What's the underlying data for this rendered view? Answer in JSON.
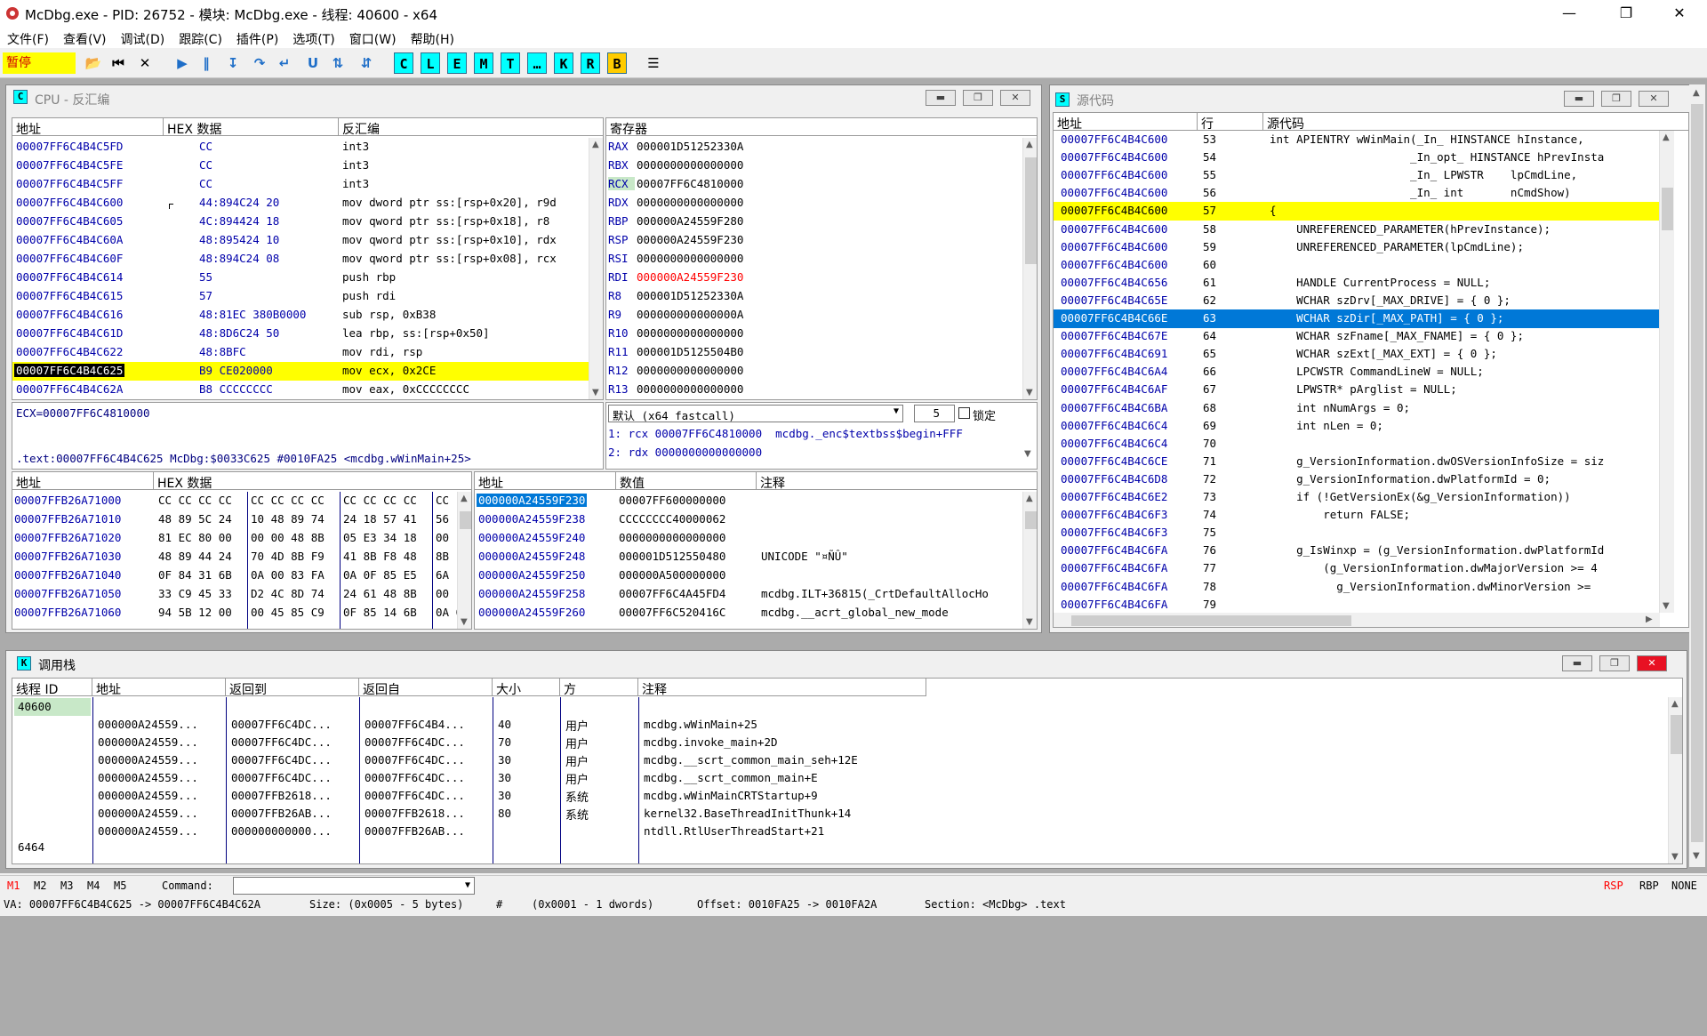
{
  "window": {
    "title": "McDbg.exe - PID: 26752 - 模块: McDbg.exe - 线程: 40600 - x64"
  },
  "menu": [
    "文件(F)",
    "查看(V)",
    "调试(D)",
    "跟踪(C)",
    "插件(P)",
    "选项(T)",
    "窗口(W)",
    "帮助(H)"
  ],
  "toolbar": {
    "state_label": "暂停",
    "letters": [
      "C",
      "L",
      "E",
      "M",
      "T",
      "…",
      "K",
      "R",
      "B"
    ]
  },
  "cpu": {
    "title": "CPU - 反汇编",
    "icon_letter": "C",
    "disasm_headers": [
      "地址",
      "HEX 数据",
      "反汇编"
    ],
    "disasm_rows": [
      {
        "addr": "00007FF6C4B4C5FD",
        "hex": "CC",
        "asm": "int3"
      },
      {
        "addr": "00007FF6C4B4C5FE",
        "hex": "CC",
        "asm": "int3"
      },
      {
        "addr": "00007FF6C4B4C5FF",
        "hex": "CC",
        "asm": "int3"
      },
      {
        "addr": "00007FF6C4B4C600",
        "hex": "44:894C24 20",
        "asm": "mov dword ptr ss:[rsp+0x20], r9d"
      },
      {
        "addr": "00007FF6C4B4C605",
        "hex": "4C:894424 18",
        "asm": "mov qword ptr ss:[rsp+0x18], r8"
      },
      {
        "addr": "00007FF6C4B4C60A",
        "hex": "48:895424 10",
        "asm": "mov qword ptr ss:[rsp+0x10], rdx"
      },
      {
        "addr": "00007FF6C4B4C60F",
        "hex": "48:894C24 08",
        "asm": "mov qword ptr ss:[rsp+0x08], rcx"
      },
      {
        "addr": "00007FF6C4B4C614",
        "hex": "55",
        "asm": "push rbp"
      },
      {
        "addr": "00007FF6C4B4C615",
        "hex": "57",
        "asm": "push rdi"
      },
      {
        "addr": "00007FF6C4B4C616",
        "hex": "48:81EC 380B0000",
        "asm": "sub rsp, 0xB38"
      },
      {
        "addr": "00007FF6C4B4C61D",
        "hex": "48:8D6C24 50",
        "asm": "lea rbp, ss:[rsp+0x50]"
      },
      {
        "addr": "00007FF6C4B4C622",
        "hex": "48:8BFC",
        "asm": "mov rdi, rsp"
      },
      {
        "addr": "00007FF6C4B4C625",
        "hex": "B9 CE020000",
        "asm": "mov ecx, 0x2CE"
      },
      {
        "addr": "00007FF6C4B4C62A",
        "hex": "B8 CCCCCCCC",
        "asm": "mov eax, 0xCCCCCCCC"
      }
    ],
    "registers_header": "寄存器",
    "registers": [
      {
        "name": "RAX",
        "value": "000001D51252330A"
      },
      {
        "name": "RBX",
        "value": "0000000000000000"
      },
      {
        "name": "RCX",
        "value": "00007FF6C4810000"
      },
      {
        "name": "RDX",
        "value": "0000000000000000"
      },
      {
        "name": "RBP",
        "value": "000000A24559F280"
      },
      {
        "name": "RSP",
        "value": "000000A24559F230"
      },
      {
        "name": "RSI",
        "value": "0000000000000000"
      },
      {
        "name": "RDI",
        "value": "000000A24559F230"
      },
      {
        "name": "R8",
        "value": "000001D51252330A"
      },
      {
        "name": "R9",
        "value": "000000000000000A"
      },
      {
        "name": "R10",
        "value": "0000000000000000"
      },
      {
        "name": "R11",
        "value": "000001D5125504B0"
      },
      {
        "name": "R12",
        "value": "0000000000000000"
      },
      {
        "name": "R13",
        "value": "0000000000000000"
      }
    ],
    "info_line1": "ECX=00007FF6C4810000",
    "info_line2": ".text:00007FF6C4B4C625 McDbg:$0033C625 #0010FA25 <mcdbg.wWinMain+25>",
    "callconv": "默认 (x64 fastcall)",
    "argcount": "5",
    "lock_label": "锁定",
    "args": [
      "1: rcx 00007FF6C4810000  mcdbg._enc$textbss$begin+FFF",
      "2: rdx 0000000000000000"
    ],
    "dump_headers": [
      "地址",
      "HEX 数据"
    ],
    "dump_rows": [
      {
        "addr": "00007FFB26A71000",
        "g1": "CC CC CC CC",
        "g2": "CC CC CC CC",
        "g3": "CC CC CC CC",
        "g4": "CC"
      },
      {
        "addr": "00007FFB26A71010",
        "g1": "48 89 5C 24",
        "g2": "10 48 89 74",
        "g3": "24 18 57 41",
        "g4": "56"
      },
      {
        "addr": "00007FFB26A71020",
        "g1": "81 EC 80 00",
        "g2": "00 00 48 8B",
        "g3": "05 E3 34 18",
        "g4": "00"
      },
      {
        "addr": "00007FFB26A71030",
        "g1": "48 89 44 24",
        "g2": "70 4D 8B F9",
        "g3": "41 8B F8 48",
        "g4": "8B"
      },
      {
        "addr": "00007FFB26A71040",
        "g1": "0F 84 31 6B",
        "g2": "0A 00 83 FA",
        "g3": "0A 0F 85 E5",
        "g4": "6A"
      },
      {
        "addr": "00007FFB26A71050",
        "g1": "33 C9 45 33",
        "g2": "D2 4C 8D 74",
        "g3": "24 61 48 8B",
        "g4": "00"
      },
      {
        "addr": "00007FFB26A71060",
        "g1": "94 5B 12 00",
        "g2": "00 45 85 C9",
        "g3": "0F 85 14 6B",
        "g4": "0A 00"
      }
    ],
    "stack_headers": [
      "地址",
      "数值",
      "注释"
    ],
    "stack_rows": [
      {
        "addr": "000000A24559F230",
        "val": "00007FF600000000",
        "note": ""
      },
      {
        "addr": "000000A24559F238",
        "val": "CCCCCCCC40000062",
        "note": ""
      },
      {
        "addr": "000000A24559F240",
        "val": "0000000000000000",
        "note": ""
      },
      {
        "addr": "000000A24559F248",
        "val": "000001D512550480",
        "note": "UNICODE \"¤ÑÛ\""
      },
      {
        "addr": "000000A24559F250",
        "val": "000000A500000000",
        "note": ""
      },
      {
        "addr": "000000A24559F258",
        "val": "00007FF6C4A45FD4",
        "note": "mcdbg.ILT+36815(_CrtDefaultAllocHo"
      },
      {
        "addr": "000000A24559F260",
        "val": "00007FF6C520416C",
        "note": "mcdbg.__acrt_global_new_mode"
      }
    ]
  },
  "source": {
    "title": "源代码",
    "icon_letter": "S",
    "headers": [
      "地址",
      "行",
      "源代码"
    ],
    "rows": [
      {
        "addr": "00007FF6C4B4C600",
        "line": "53",
        "code": "int APIENTRY wWinMain(_In_ HINSTANCE hInstance,"
      },
      {
        "addr": "00007FF6C4B4C600",
        "line": "54",
        "code": "                     _In_opt_ HINSTANCE hPrevInsta"
      },
      {
        "addr": "00007FF6C4B4C600",
        "line": "55",
        "code": "                     _In_ LPWSTR    lpCmdLine,"
      },
      {
        "addr": "00007FF6C4B4C600",
        "line": "56",
        "code": "                     _In_ int       nCmdShow)"
      },
      {
        "addr": "00007FF6C4B4C600",
        "line": "57",
        "code": "{"
      },
      {
        "addr": "00007FF6C4B4C600",
        "line": "58",
        "code": "    UNREFERENCED_PARAMETER(hPrevInstance);"
      },
      {
        "addr": "00007FF6C4B4C600",
        "line": "59",
        "code": "    UNREFERENCED_PARAMETER(lpCmdLine);"
      },
      {
        "addr": "00007FF6C4B4C600",
        "line": "60",
        "code": ""
      },
      {
        "addr": "00007FF6C4B4C656",
        "line": "61",
        "code": "    HANDLE CurrentProcess = NULL;"
      },
      {
        "addr": "00007FF6C4B4C65E",
        "line": "62",
        "code": "    WCHAR szDrv[_MAX_DRIVE] = { 0 };"
      },
      {
        "addr": "00007FF6C4B4C66E",
        "line": "63",
        "code": "    WCHAR szDir[_MAX_PATH] = { 0 };"
      },
      {
        "addr": "00007FF6C4B4C67E",
        "line": "64",
        "code": "    WCHAR szFname[_MAX_FNAME] = { 0 };"
      },
      {
        "addr": "00007FF6C4B4C691",
        "line": "65",
        "code": "    WCHAR szExt[_MAX_EXT] = { 0 };"
      },
      {
        "addr": "00007FF6C4B4C6A4",
        "line": "66",
        "code": "    LPCWSTR CommandLineW = NULL;"
      },
      {
        "addr": "00007FF6C4B4C6AF",
        "line": "67",
        "code": "    LPWSTR* pArglist = NULL;"
      },
      {
        "addr": "00007FF6C4B4C6BA",
        "line": "68",
        "code": "    int nNumArgs = 0;"
      },
      {
        "addr": "00007FF6C4B4C6C4",
        "line": "69",
        "code": "    int nLen = 0;"
      },
      {
        "addr": "00007FF6C4B4C6C4",
        "line": "70",
        "code": ""
      },
      {
        "addr": "00007FF6C4B4C6CE",
        "line": "71",
        "code": "    g_VersionInformation.dwOSVersionInfoSize = siz"
      },
      {
        "addr": "00007FF6C4B4C6D8",
        "line": "72",
        "code": "    g_VersionInformation.dwPlatformId = 0;"
      },
      {
        "addr": "00007FF6C4B4C6E2",
        "line": "73",
        "code": "    if (!GetVersionEx(&g_VersionInformation))"
      },
      {
        "addr": "00007FF6C4B4C6F3",
        "line": "74",
        "code": "        return FALSE;"
      },
      {
        "addr": "00007FF6C4B4C6F3",
        "line": "75",
        "code": ""
      },
      {
        "addr": "00007FF6C4B4C6FA",
        "line": "76",
        "code": "    g_IsWinxp = (g_VersionInformation.dwPlatformId"
      },
      {
        "addr": "00007FF6C4B4C6FA",
        "line": "77",
        "code": "        (g_VersionInformation.dwMajorVersion >= 4"
      },
      {
        "addr": "00007FF6C4B4C6FA",
        "line": "78",
        "code": "          g_VersionInformation.dwMinorVersion >="
      },
      {
        "addr": "00007FF6C4B4C6FA",
        "line": "79",
        "code": ""
      }
    ]
  },
  "callstack": {
    "title": "调用栈",
    "icon_letter": "K",
    "headers": [
      "线程 ID",
      "地址",
      "返回到",
      "返回自",
      "大小",
      "方",
      "注释"
    ],
    "threads": [
      {
        "id": "40600"
      },
      {
        "id": "6464"
      }
    ],
    "rows": [
      {
        "addr": "000000A24559...",
        "ret_to": "00007FF6C4DC...",
        "ret_from": "00007FF6C4B4...",
        "size": "40",
        "party": "用户",
        "note": "mcdbg.wWinMain+25"
      },
      {
        "addr": "000000A24559...",
        "ret_to": "00007FF6C4DC...",
        "ret_from": "00007FF6C4DC...",
        "size": "70",
        "party": "用户",
        "note": "mcdbg.invoke_main+2D"
      },
      {
        "addr": "000000A24559...",
        "ret_to": "00007FF6C4DC...",
        "ret_from": "00007FF6C4DC...",
        "size": "30",
        "party": "用户",
        "note": "mcdbg.__scrt_common_main_seh+12E"
      },
      {
        "addr": "000000A24559...",
        "ret_to": "00007FF6C4DC...",
        "ret_from": "00007FF6C4DC...",
        "size": "30",
        "party": "用户",
        "note": "mcdbg.__scrt_common_main+E"
      },
      {
        "addr": "000000A24559...",
        "ret_to": "00007FFB2618...",
        "ret_from": "00007FF6C4DC...",
        "size": "30",
        "party": "系统",
        "note": "mcdbg.wWinMainCRTStartup+9"
      },
      {
        "addr": "000000A24559...",
        "ret_to": "00007FFB26AB...",
        "ret_from": "00007FFB2618...",
        "size": "80",
        "party": "系统",
        "note": "kernel32.BaseThreadInitThunk+14"
      },
      {
        "addr": "000000A24559...",
        "ret_to": "000000000000...",
        "ret_from": "00007FFB26AB...",
        "size": "",
        "party": "",
        "note": "ntdll.RtlUserThreadStart+21"
      }
    ]
  },
  "commandbar": {
    "tabs": [
      "M1",
      "M2",
      "M3",
      "M4",
      "M5"
    ],
    "label": "Command:",
    "regs": [
      "RSP",
      "RBP",
      "NONE"
    ]
  },
  "status": {
    "va": "VA: 00007FF6C4B4C625 -> 00007FF6C4B4C62A",
    "size": "Size: (0x0005 - 5 bytes)",
    "hash": "#",
    "dwords": "(0x0001 - 1 dwords)",
    "offset": "Offset: 0010FA25 -> 0010FA2A",
    "section": "Section: <McDbg> .text"
  },
  "colors": {
    "highlight_yellow": "#ffff00",
    "selection_blue": "#0078d7",
    "cyan_button": "#00ffff",
    "reg_changed_red": "#ff0000",
    "text_blue": "#0000aa"
  }
}
